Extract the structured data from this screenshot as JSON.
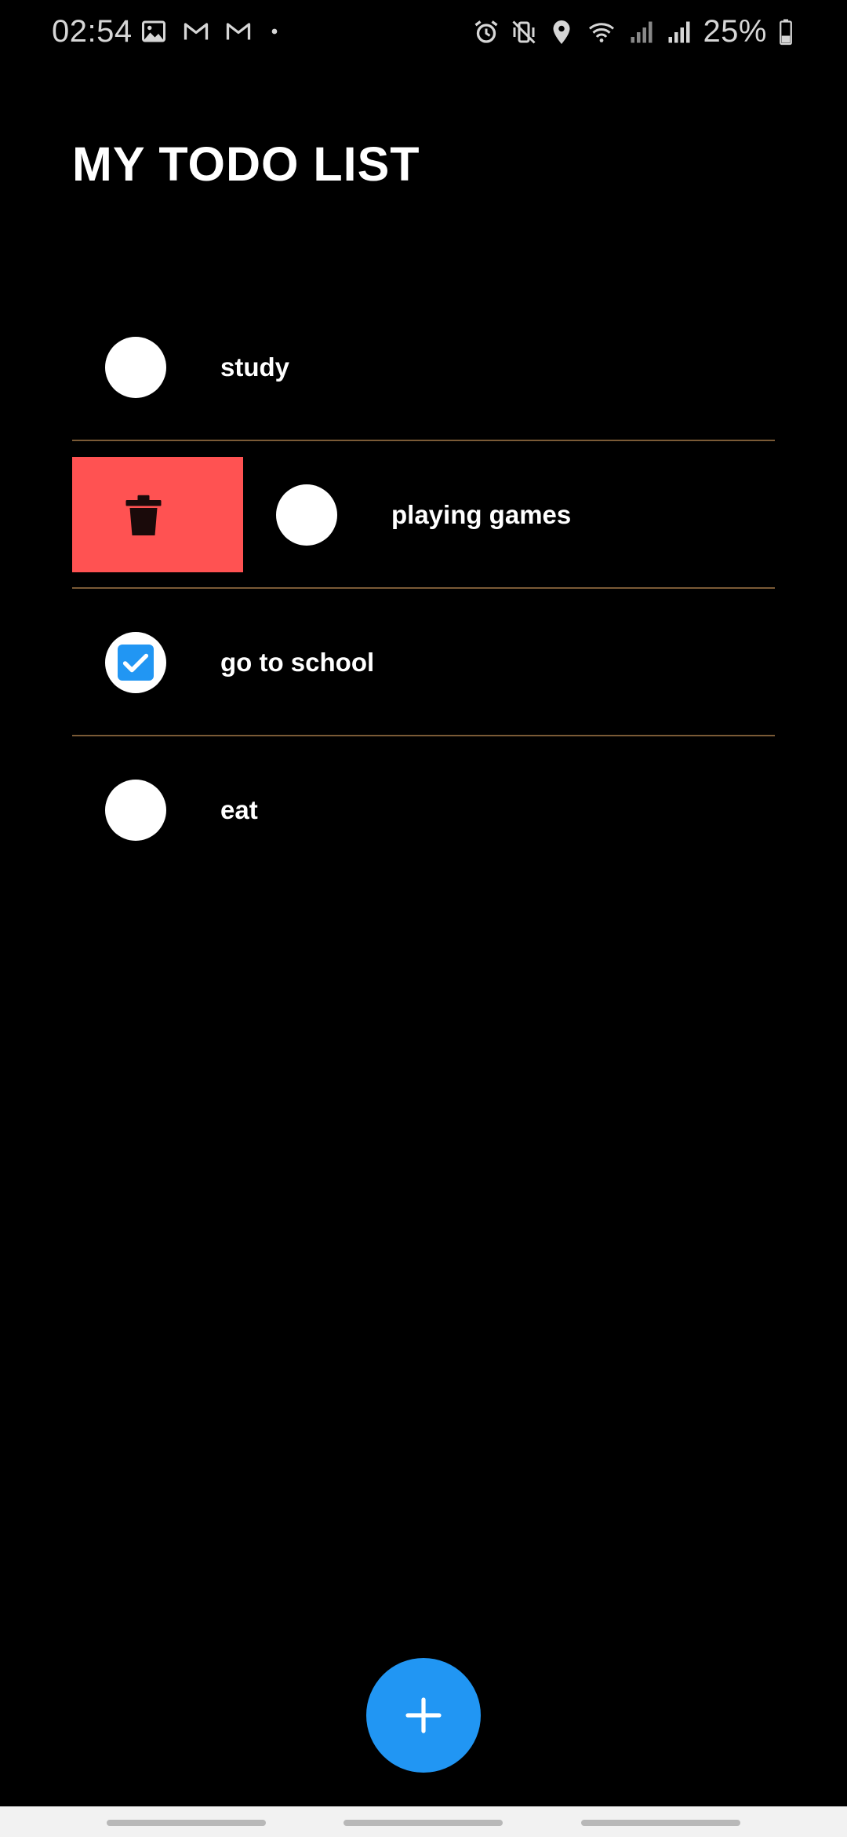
{
  "status_bar": {
    "time": "02:54",
    "battery": "25%",
    "left_icons": [
      "gallery-icon",
      "gmail-icon",
      "gmail-icon",
      "dot-icon"
    ],
    "right_icons": [
      "alarm-icon",
      "vibrate-icon",
      "location-icon",
      "wifi-icon",
      "signal-icon",
      "signal-icon",
      "battery-icon"
    ]
  },
  "title": "MY TODO LIST",
  "todos": [
    {
      "label": "study",
      "done": false
    },
    {
      "label": "playing games",
      "done": false,
      "swiped": true
    },
    {
      "label": "go to school",
      "done": true
    },
    {
      "label": "eat",
      "done": false
    }
  ],
  "fab": {
    "icon": "plus-icon"
  },
  "colors": {
    "background": "#000000",
    "accent": "#2196f3",
    "delete": "#ff5252",
    "divider": "#7a5a36",
    "text": "#ffffff"
  }
}
